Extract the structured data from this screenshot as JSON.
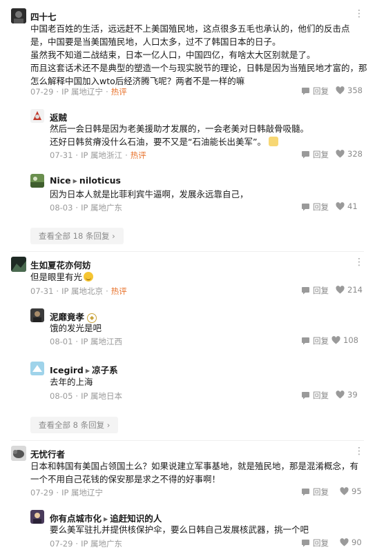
{
  "ui": {
    "reply_label": "回复",
    "hot_label": "热评",
    "more_glyph": "⋮"
  },
  "comments": [
    {
      "user": "四十七",
      "lines": [
        "中国老百姓的生活，远远赶不上美国殖民地，这点很多五毛也承认的，他们的反击点",
        "是，中国要是当美国殖民地，人口太多，过不了韩国日本的日子。",
        "虽然我不知道二战结束，日本一亿人口，中国四亿，有啥太大区别就是了。",
        "而且这套话术还不是典型的塑造一个与现实脱节的理论，日韩是因为当殖民地才富的，那",
        "怎么解释中国加入wto后经济腾飞呢？两者不是一样的嘛"
      ],
      "date": "07-29",
      "location": "IP 属地辽宁",
      "hot": true,
      "likes": "358",
      "replies": [
        {
          "user": "返贼",
          "lines": [
            "然后一会日韩是因为老美援助才发展的，一会老美对日韩敲骨吸髓。",
            "还好日韩贫瘠没什么石油，要不又是“石油能长出美军”。"
          ],
          "date": "07-31",
          "location": "IP 属地浙江",
          "hot": true,
          "likes": "328"
        },
        {
          "user": "Nice",
          "reply_to": "niloticus",
          "lines": [
            "因为日本人就是比菲利宾牛逼啊，发展永远靠自己，"
          ],
          "date": "08-03",
          "location": "IP 属地广东",
          "hot": false,
          "likes": "41"
        }
      ],
      "expand_label": "查看全部 18 条回复 ›"
    },
    {
      "user": "生如夏花亦何妨",
      "lines": [
        "但是眼里有光"
      ],
      "date": "07-31",
      "location": "IP 属地北京",
      "hot": true,
      "likes": "214",
      "replies": [
        {
          "user": "泥靡竟孝",
          "lines": [
            "饿的发光是吧"
          ],
          "date": "08-01",
          "location": "IP 属地江西",
          "hot": false,
          "likes": "108"
        },
        {
          "user": "Icegird",
          "reply_to": "凉子系",
          "lines": [
            "去年的上海"
          ],
          "date": "08-05",
          "location": "IP 属地日本",
          "hot": false,
          "likes": "39"
        }
      ],
      "expand_label": "查看全部 8 条回复 ›"
    },
    {
      "user": "无忧行者",
      "lines": [
        "日本和韩国有美国占领国土么？如果说建立军事基地，就是殖民地，那是混淆概念，有",
        "一个不用自己花钱的保安那是求之不得的好事啊！"
      ],
      "date": "07-29",
      "location": "IP 属地辽宁",
      "hot": false,
      "likes": "95",
      "replies": [
        {
          "user": "你有点城市化",
          "reply_to": "追赶知识的人",
          "lines": [
            "要么美军驻扎并提供核保护伞，要么日韩自己发展核武器，挑一个吧"
          ],
          "date": "07-29",
          "location": "IP 属地广东",
          "hot": false,
          "likes": "90"
        }
      ]
    }
  ]
}
